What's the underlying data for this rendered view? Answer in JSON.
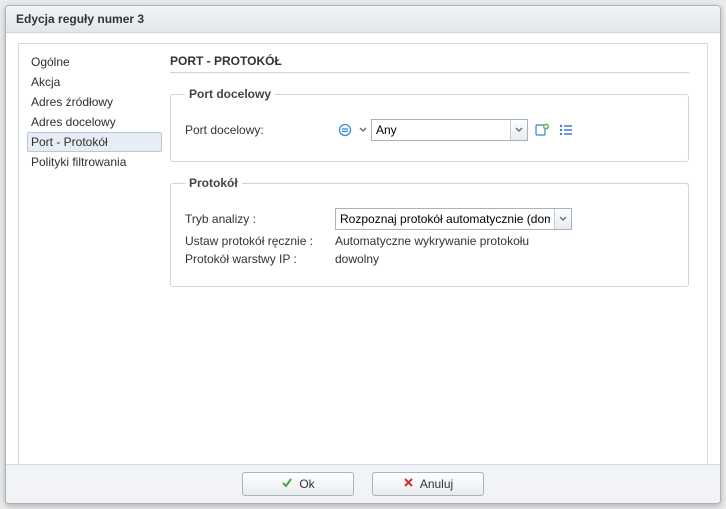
{
  "dialog": {
    "title": "Edycja reguły numer 3"
  },
  "sidebar": {
    "items": [
      {
        "label": "Ogólne"
      },
      {
        "label": "Akcja"
      },
      {
        "label": "Adres źródłowy"
      },
      {
        "label": "Adres docelowy"
      },
      {
        "label": "Port - Protokół",
        "selected": true
      },
      {
        "label": "Polityki filtrowania"
      }
    ]
  },
  "section": {
    "title": "PORT - PROTOKÓŁ"
  },
  "port_group": {
    "legend": "Port docelowy",
    "row_label": "Port docelowy:",
    "value": "Any"
  },
  "proto_group": {
    "legend": "Protokół",
    "analysis_label": "Tryb analizy :",
    "analysis_value": "Rozpoznaj protokół automatycznie (domyślnie)",
    "manual_label": "Ustaw protokół ręcznie :",
    "manual_value": "Automatyczne wykrywanie protokołu",
    "ip_label": "Protokół warstwy IP :",
    "ip_value": "dowolny"
  },
  "buttons": {
    "ok": "Ok",
    "cancel": "Anuluj"
  }
}
